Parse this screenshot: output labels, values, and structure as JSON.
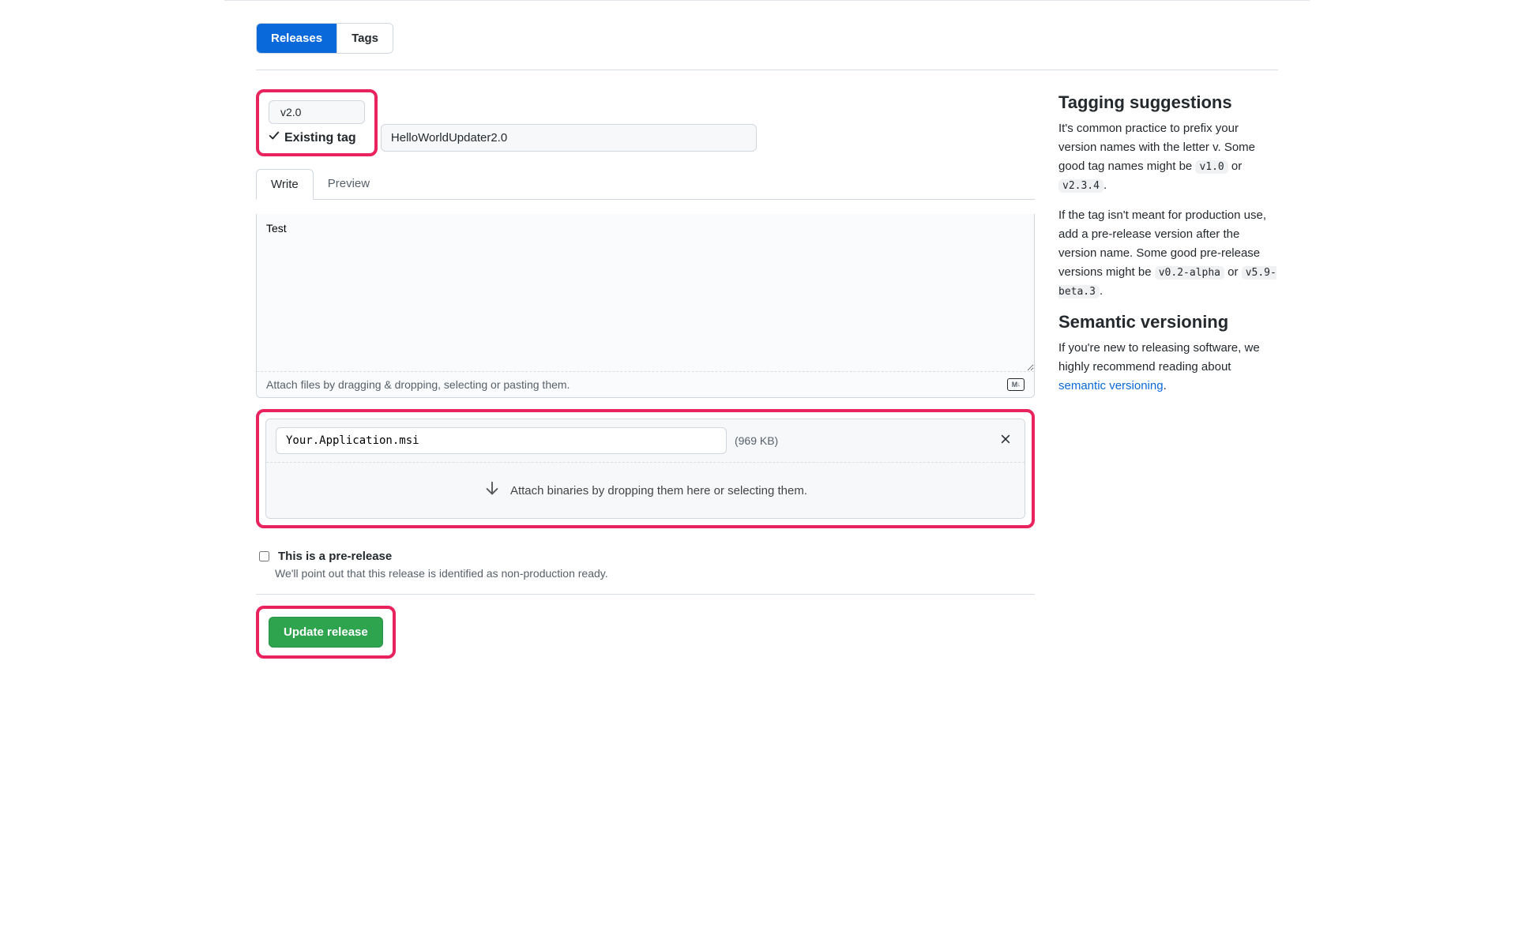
{
  "nav": {
    "releases": "Releases",
    "tags": "Tags"
  },
  "tag": {
    "value": "v2.0",
    "status": "Existing tag"
  },
  "release_title": "HelloWorldUpdater2.0",
  "editor": {
    "write_tab": "Write",
    "preview_tab": "Preview",
    "body": "Test",
    "attach_hint": "Attach files by dragging & dropping, selecting or pasting them.",
    "md_label": "M"
  },
  "binaries": {
    "file_name": "Your.Application.msi",
    "file_size": "(969 KB)",
    "drop_hint": "Attach binaries by dropping them here or selecting them."
  },
  "prerelease": {
    "label": "This is a pre-release",
    "desc": "We'll point out that this release is identified as non-production ready."
  },
  "buttons": {
    "update": "Update release"
  },
  "sidebar": {
    "tagging_heading": "Tagging suggestions",
    "tagging_p1_a": "It's common practice to prefix your version names with the letter ",
    "tagging_p1_v": "v",
    "tagging_p1_b": ". Some good tag names might be ",
    "tagging_p1_code1": "v1.0",
    "tagging_p1_or": " or ",
    "tagging_p1_code2": "v2.3.4",
    "tagging_p1_dot": ".",
    "tagging_p2_a": "If the tag isn't meant for production use, add a pre-release version after the version name. Some good pre-release versions might be ",
    "tagging_p2_code1": "v0.2-alpha",
    "tagging_p2_or": " or ",
    "tagging_p2_code2": "v5.9-beta.3",
    "tagging_p2_dot": ".",
    "semver_heading": "Semantic versioning",
    "semver_p_a": "If you're new to releasing software, we highly recommend reading about ",
    "semver_link": "semantic versioning",
    "semver_p_dot": "."
  }
}
